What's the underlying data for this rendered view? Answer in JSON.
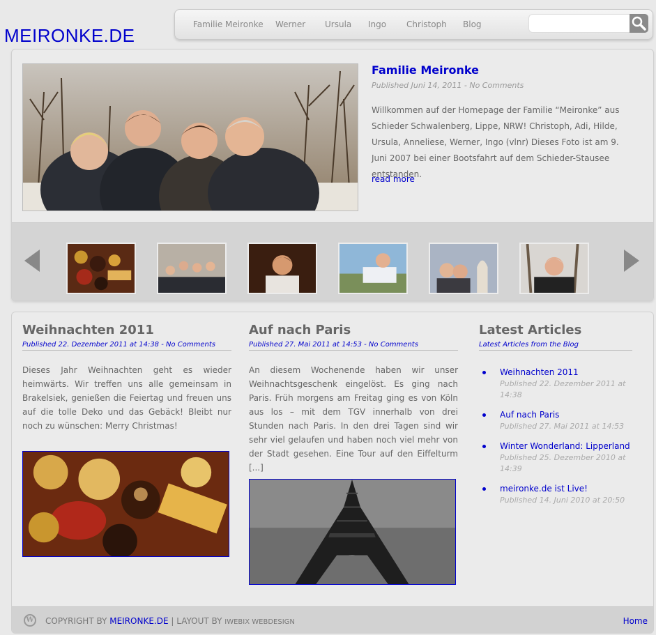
{
  "site": {
    "logo": "MEIRONKE.DE"
  },
  "nav": {
    "items": [
      "Familie Meironke",
      "Werner",
      "Ursula",
      "Ingo",
      "Christoph",
      "Blog"
    ]
  },
  "search": {
    "placeholder": ""
  },
  "icons": {
    "search": "search-icon",
    "prev": "arrow-left-icon",
    "next": "arrow-right-icon",
    "wordpress": "wordpress-icon"
  },
  "colors": {
    "link": "#0000cc",
    "background": "#e9e9e9",
    "strip": "#d4d4d4"
  },
  "feature": {
    "title": "Familie Meironke",
    "meta": "Published Juni 14, 2011 - No Comments",
    "text": "Willkommen auf der Homepage der Familie “Meironke” aus Schieder Schwalenberg, Lippe, NRW! Christoph, Adi, Hilde, Ursula, Anneliese, Werner, Ingo (vlnr) Dieses Foto ist am 9. Juni 2007 bei einer Bootsfahrt auf dem Schieder-Stausee entstanden.",
    "read_more": "read more"
  },
  "posts": [
    {
      "title": "Weihnachten 2011",
      "meta": "Published 22. Dezember 2011 at 14:38 - No Comments",
      "text": "Dieses Jahr Weihnachten geht es wieder heimwärts. Wir treffen uns alle gemeinsam in Brakelsiek, genießen die Feiertag und freuen uns auf die tolle Deko und das Gebäck!  Bleibt nur noch zu wünschen: Merry Christmas!"
    },
    {
      "title": "Auf nach Paris",
      "meta": "Published 27. Mai 2011 at 14:53 - No Comments",
      "text": "An diesem Wochenende haben wir unser Weihnachtsgeschenk eingelöst. Es ging nach Paris. Früh morgens am Freitag ging es von Köln aus los – mit dem TGV innerhalb von drei Stunden nach Paris. In den drei Tagen sind wir sehr viel gelaufen und haben noch viel mehr von der Stadt gesehen. Eine Tour auf den Eiffelturm [...]"
    }
  ],
  "sidebar": {
    "title": "Latest Articles",
    "subtitle": "Latest Articles from the Blog",
    "items": [
      {
        "title": "Weihnachten 2011",
        "date": "Published 22. Dezember 2011 at 14:38"
      },
      {
        "title": "Auf nach Paris",
        "date": "Published 27. Mai 2011 at 14:53"
      },
      {
        "title": "Winter Wonderland: Lipperland",
        "date": "Published 25. Dezember 2010 at 14:39"
      },
      {
        "title": "meironke.de ist Live!",
        "date": "Published 14. Juni 2010 at 20:50"
      }
    ]
  },
  "footer": {
    "copyright": "COPYRIGHT BY",
    "site_link": "MEIRONKE.DE",
    "separator": "|",
    "layout_by": "LAYOUT BY",
    "designer": "IWEBIX WEBDESIGN",
    "home": "Home"
  }
}
